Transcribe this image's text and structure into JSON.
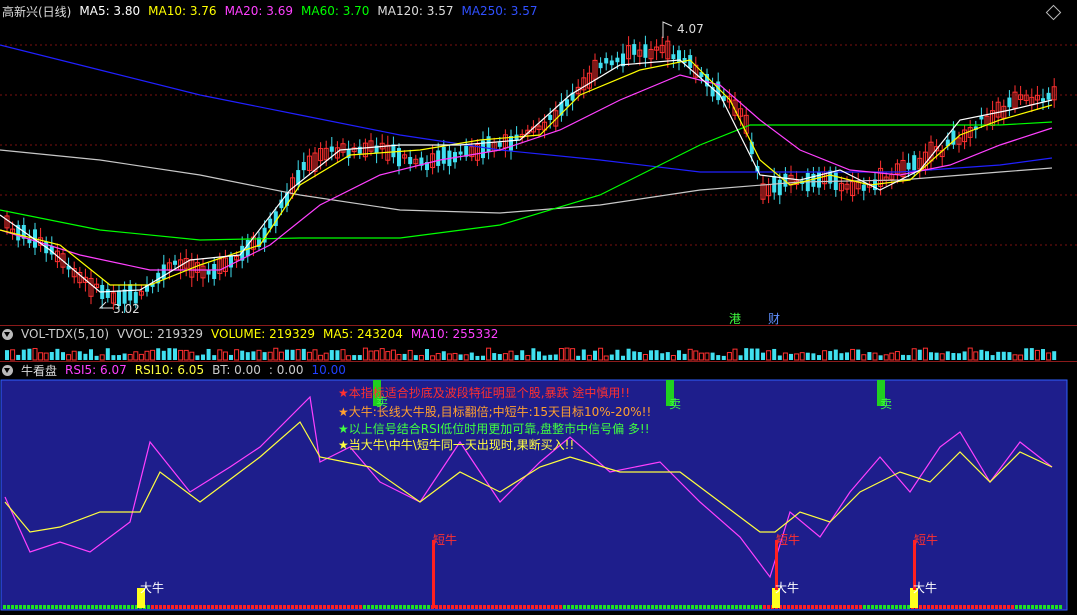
{
  "main": {
    "title": "高新兴(日线)",
    "ma5": "MA5: 3.80",
    "ma10": "MA10: 3.76",
    "ma20": "MA20: 3.69",
    "ma60": "MA60: 3.70",
    "ma120": "MA120: 3.57",
    "ma250": "MA250: 3.57",
    "high_label": "4.07",
    "low_label": "3.02",
    "event_tags": [
      "港",
      "财"
    ],
    "colors": {
      "ma5": "#ffffff",
      "ma10": "#ffff00",
      "ma20": "#ff40ff",
      "ma60": "#00ff00",
      "ma120": "#c8c8c8",
      "ma250": "#2020ff",
      "up": "#ff3030",
      "down": "#40e0f0"
    }
  },
  "volume": {
    "name": "VOL-TDX(5,10)",
    "vvol": "VVOL: 219329",
    "volume": "VOLUME: 219329",
    "ma5": "MA5: 243204",
    "ma10": "MA10: 255332"
  },
  "indicator": {
    "name": "牛看盘",
    "rsi5": "RSI5: 6.07",
    "rsi10": "RSI10: 6.05",
    "bt": "BT: 0.00",
    "bt2": ": 0.00",
    "val": "10.00",
    "notes": [
      {
        "star": "★",
        "text": "本指标适合抄底及波段特征明显个股,暴跌 途中慎用!!"
      },
      {
        "star": "★",
        "text": "大牛:长线大牛股,目标翻倍;中短牛:15天目标10%-20%!!"
      },
      {
        "star": "★",
        "text": "以上信号结合RSI低位时用更加可靠,盘整市中信号偏 多!!"
      },
      {
        "star": "★",
        "text": "当大牛\\中牛\\短牛同一天出现时,果断买入!!"
      }
    ],
    "signal_labels": {
      "sell": "卖",
      "short_bull": "短牛",
      "big_bull": "大牛"
    },
    "colors": {
      "background": "#1e1e8c",
      "rsi5": "#ff40ff",
      "rsi10": "#ffff40",
      "note1": "#ff3030",
      "note2": "#ffa030",
      "note3": "#40ff40",
      "note4": "#ffff40"
    }
  }
}
